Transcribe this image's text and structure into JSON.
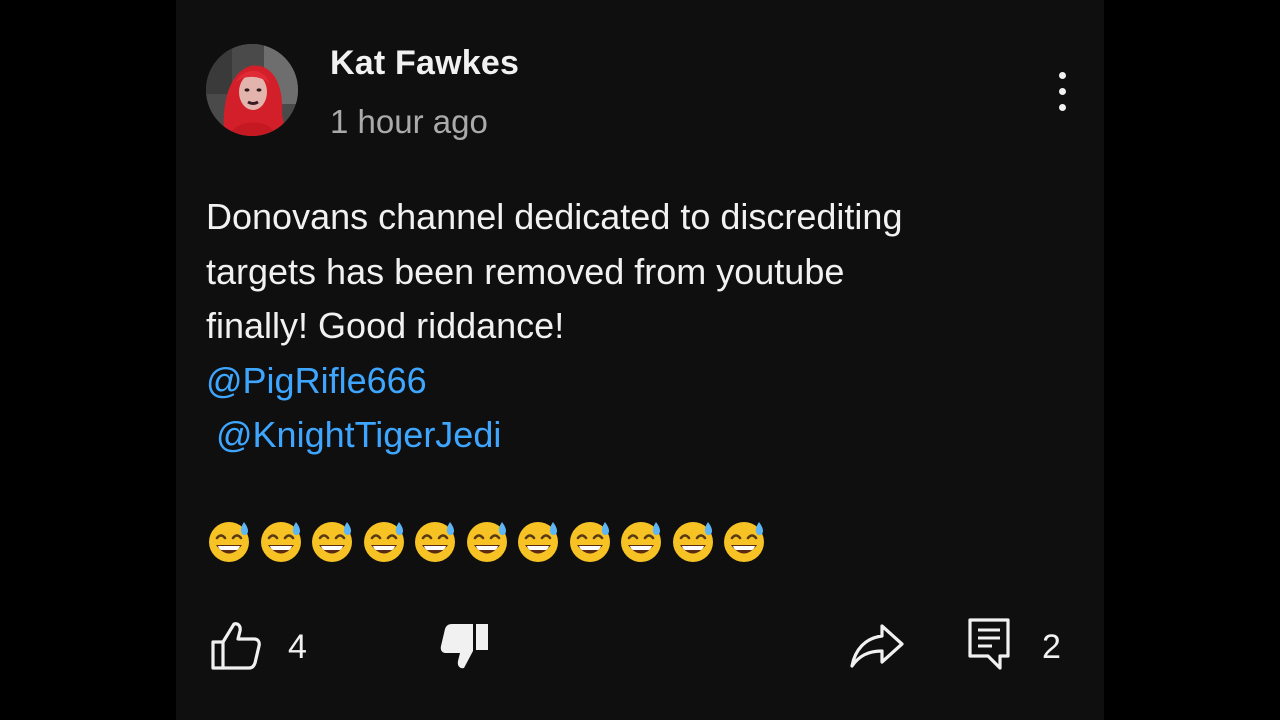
{
  "comment": {
    "author": "Kat Fawkes",
    "timestamp": "1 hour ago",
    "lines": [
      "Donovans channel dedicated to discrediting",
      "targets has been removed from youtube",
      "finally! Good riddance!"
    ],
    "mentions": [
      "@PigRifle666",
      " @KnightTigerJedi"
    ],
    "emoji_count": 11,
    "emoji_icon": "grinning-face-with-sweat-icon"
  },
  "actions": {
    "like_count": "4",
    "reply_count": "2",
    "like_icon": "thumbs-up-icon",
    "dislike_icon": "thumbs-down-icon",
    "share_icon": "share-icon",
    "reply_icon": "comment-icon",
    "menu_icon": "more-vertical-icon"
  },
  "colors": {
    "background": "#0f0f0f",
    "text": "#f1f1f1",
    "secondary_text": "#aaaaaa",
    "mention": "#3ea6ff"
  }
}
